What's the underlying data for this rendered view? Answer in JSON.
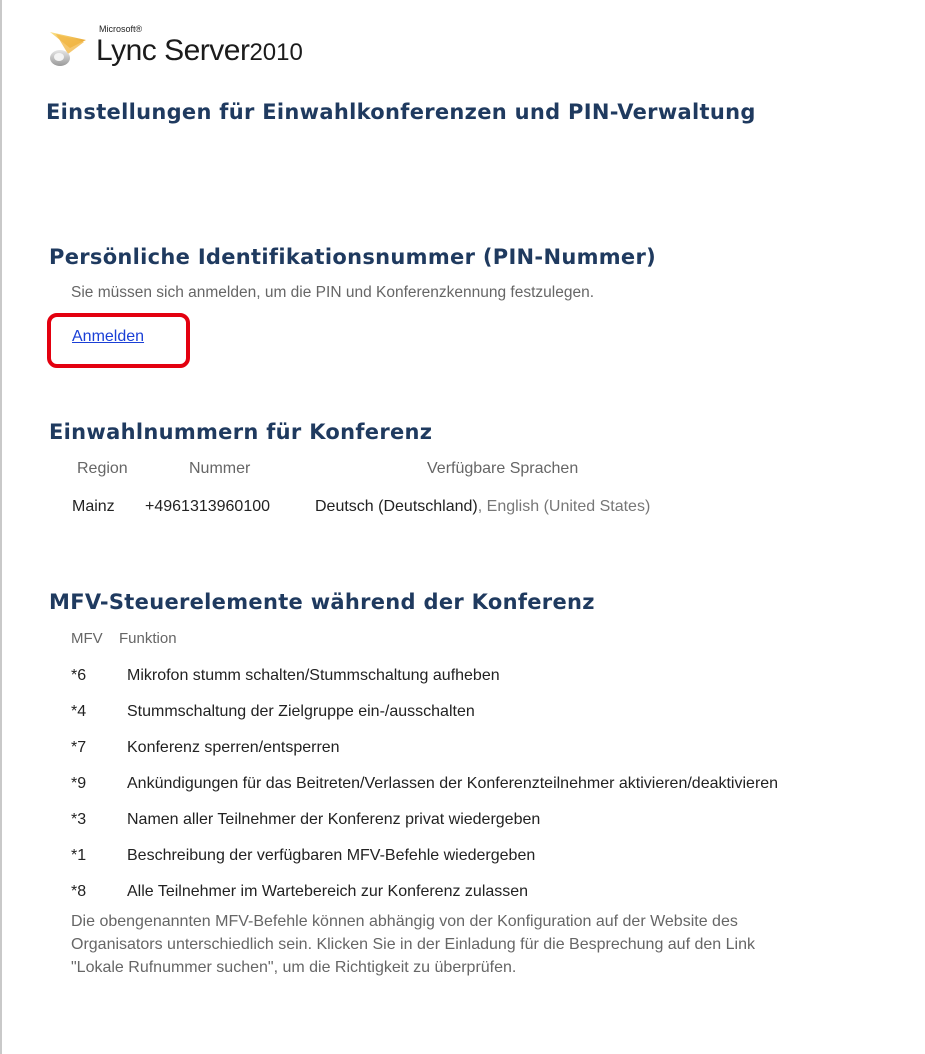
{
  "logo": {
    "microsoft": "Microsoft®",
    "brand": "Lync Server",
    "year": "2010"
  },
  "page_title": "Einstellungen für Einwahlkonferenzen und PIN-Verwaltung",
  "pin_section": {
    "title": "Persönliche Identifikationsnummer (PIN-Nummer)",
    "description": "Sie müssen sich anmelden, um die PIN und Konferenzkennung festzulegen.",
    "login_link": "Anmelden",
    "highlight_color": "#e3000f"
  },
  "dialin_section": {
    "title": "Einwahlnummern für Konferenz",
    "headers": {
      "region": "Region",
      "number": "Nummer",
      "languages": "Verfügbare Sprachen"
    },
    "rows": [
      {
        "region": "Mainz",
        "number": "+4961313960100",
        "primary_language": "Deutsch (Deutschland)",
        "other_languages": ", English (United States)"
      }
    ]
  },
  "dtmf_section": {
    "title": "MFV-Steuerelemente während der Konferenz",
    "headers": {
      "code": "MFV",
      "function": "Funktion"
    },
    "rows": [
      {
        "code": "*6",
        "function": "Mikrofon stumm schalten/Stummschaltung aufheben"
      },
      {
        "code": "*4",
        "function": "Stummschaltung der Zielgruppe ein-/ausschalten"
      },
      {
        "code": "*7",
        "function": "Konferenz sperren/entsperren"
      },
      {
        "code": "*9",
        "function": "Ankündigungen für das Beitreten/Verlassen der Konferenzteilnehmer aktivieren/deaktivieren"
      },
      {
        "code": "*3",
        "function": "Namen aller Teilnehmer der Konferenz privat wiedergeben"
      },
      {
        "code": "*1",
        "function": "Beschreibung der verfügbaren MFV-Befehle wiedergeben"
      },
      {
        "code": "*8",
        "function": "Alle Teilnehmer im Wartebereich zur Konferenz zulassen"
      }
    ],
    "note": "Die obengenannten MFV-Befehle können abhängig von der Konfiguration auf der Website des Organisators unterschiedlich sein. Klicken Sie in der Einladung für die Besprechung auf den Link \"Lokale Rufnummer suchen\", um die Richtigkeit zu überprüfen."
  },
  "colors": {
    "heading": "#1f3a5f",
    "link": "#1a3fd6",
    "muted_text": "#666666"
  }
}
